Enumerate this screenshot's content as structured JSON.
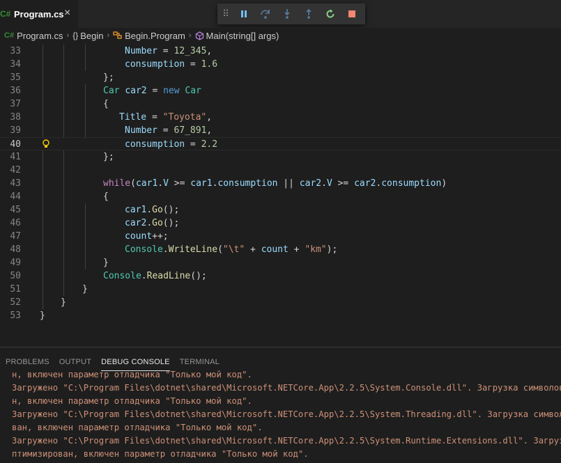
{
  "tab": {
    "lang_badge": "C#",
    "filename": "Program.cs",
    "close": "×"
  },
  "debug_toolbar": {
    "grip": "⠿",
    "pause": "pause-icon",
    "step_over": "step-over-icon",
    "step_into": "step-into-icon",
    "step_out": "step-out-icon",
    "restart": "restart-icon",
    "stop": "stop-icon",
    "colors": {
      "blue": "#75beff",
      "green": "#89d185",
      "red": "#f48771"
    }
  },
  "breadcrumb": {
    "badge": "C#",
    "file": "Program.cs",
    "namespace": "Begin",
    "namespace_icon": "{}",
    "class": "Begin.Program",
    "method": "Main(string[] args)"
  },
  "editor": {
    "current_line": "40",
    "lines": [
      {
        "n": "33",
        "tokens": [
          [
            "t-id",
            "Number"
          ],
          [
            "t-pl",
            " = "
          ],
          [
            "t-num",
            "12_345"
          ],
          [
            "t-pl",
            ","
          ]
        ]
      },
      {
        "n": "34",
        "tokens": [
          [
            "t-id",
            "consumption"
          ],
          [
            "t-pl",
            " = "
          ],
          [
            "t-num",
            "1.6"
          ]
        ]
      },
      {
        "n": "35",
        "tokens": [
          [
            "t-pl",
            "};"
          ]
        ]
      },
      {
        "n": "36",
        "tokens": [
          [
            "t-ty",
            "Car"
          ],
          [
            "t-pl",
            " "
          ],
          [
            "t-id",
            "car2"
          ],
          [
            "t-pl",
            " = "
          ],
          [
            "t-kw",
            "new"
          ],
          [
            "t-pl",
            " "
          ],
          [
            "t-ty",
            "Car"
          ]
        ]
      },
      {
        "n": "37",
        "tokens": [
          [
            "t-pl",
            "{"
          ]
        ]
      },
      {
        "n": "38",
        "tokens": [
          [
            "t-id",
            "Title"
          ],
          [
            "t-pl",
            " = "
          ],
          [
            "t-str",
            "\"Toyota\""
          ],
          [
            "t-pl",
            ","
          ]
        ]
      },
      {
        "n": "39",
        "tokens": [
          [
            "t-id",
            "Number"
          ],
          [
            "t-pl",
            " = "
          ],
          [
            "t-num",
            "67_891"
          ],
          [
            "t-pl",
            ","
          ]
        ]
      },
      {
        "n": "40",
        "tokens": [
          [
            "t-id",
            "consumption"
          ],
          [
            "t-pl",
            " = "
          ],
          [
            "t-num",
            "2.2"
          ]
        ]
      },
      {
        "n": "41",
        "tokens": [
          [
            "t-pl",
            "};"
          ]
        ]
      },
      {
        "n": "42",
        "tokens": []
      },
      {
        "n": "43",
        "tokens": [
          [
            "t-ctl",
            "while"
          ],
          [
            "t-pl",
            "("
          ],
          [
            "t-id",
            "car1"
          ],
          [
            "t-pl",
            "."
          ],
          [
            "t-id",
            "V"
          ],
          [
            "t-pl",
            " >= "
          ],
          [
            "t-id",
            "car1"
          ],
          [
            "t-pl",
            "."
          ],
          [
            "t-id",
            "consumption"
          ],
          [
            "t-pl",
            " || "
          ],
          [
            "t-id",
            "car2"
          ],
          [
            "t-pl",
            "."
          ],
          [
            "t-id",
            "V"
          ],
          [
            "t-pl",
            " >= "
          ],
          [
            "t-id",
            "car2"
          ],
          [
            "t-pl",
            "."
          ],
          [
            "t-id",
            "consumption"
          ],
          [
            "t-pl",
            ")"
          ]
        ]
      },
      {
        "n": "44",
        "tokens": [
          [
            "t-pl",
            "{"
          ]
        ]
      },
      {
        "n": "45",
        "tokens": [
          [
            "t-id",
            "car1"
          ],
          [
            "t-pl",
            "."
          ],
          [
            "t-fn",
            "Go"
          ],
          [
            "t-pl",
            "();"
          ]
        ]
      },
      {
        "n": "46",
        "tokens": [
          [
            "t-id",
            "car2"
          ],
          [
            "t-pl",
            "."
          ],
          [
            "t-fn",
            "Go"
          ],
          [
            "t-pl",
            "();"
          ]
        ]
      },
      {
        "n": "47",
        "tokens": [
          [
            "t-id",
            "count"
          ],
          [
            "t-pl",
            "++;"
          ]
        ]
      },
      {
        "n": "48",
        "tokens": [
          [
            "t-ty",
            "Console"
          ],
          [
            "t-pl",
            "."
          ],
          [
            "t-fn",
            "WriteLine"
          ],
          [
            "t-pl",
            "("
          ],
          [
            "t-str",
            "\"\\t\""
          ],
          [
            "t-pl",
            " + "
          ],
          [
            "t-id",
            "count"
          ],
          [
            "t-pl",
            " + "
          ],
          [
            "t-str",
            "\"km\""
          ],
          [
            "t-pl",
            ");"
          ]
        ]
      },
      {
        "n": "49",
        "tokens": [
          [
            "t-pl",
            "}"
          ]
        ]
      },
      {
        "n": "50",
        "tokens": [
          [
            "t-ty",
            "Console"
          ],
          [
            "t-pl",
            "."
          ],
          [
            "t-fn",
            "ReadLine"
          ],
          [
            "t-pl",
            "();"
          ]
        ]
      },
      {
        "n": "51",
        "tokens": [
          [
            "t-pl",
            "}"
          ]
        ]
      },
      {
        "n": "52",
        "tokens": [
          [
            "t-pl",
            "}"
          ]
        ]
      },
      {
        "n": "53",
        "tokens": [
          [
            "t-pl",
            "}"
          ]
        ]
      }
    ]
  },
  "panel": {
    "tabs": [
      "PROBLEMS",
      "OUTPUT",
      "DEBUG CONSOLE",
      "TERMINAL"
    ],
    "active_tab": "DEBUG CONSOLE",
    "output_lines": [
      "н, включен параметр отладчика \"Только мой код\".",
      "Загружено \"C:\\Program Files\\dotnet\\shared\\Microsoft.NETCore.App\\2.2.5\\System.Console.dll\". Загрузка символов пропуще",
      "н, включен параметр отладчика \"Только мой код\".",
      "Загружено \"C:\\Program Files\\dotnet\\shared\\Microsoft.NETCore.App\\2.2.5\\System.Threading.dll\". Загрузка символов пропуще",
      "ван, включен параметр отладчика \"Только мой код\".",
      "Загружено \"C:\\Program Files\\dotnet\\shared\\Microsoft.NETCore.App\\2.2.5\\System.Runtime.Extensions.dll\". Загрузка символов",
      "птимизирован, включен параметр отладчика \"Только мой код\"."
    ]
  }
}
